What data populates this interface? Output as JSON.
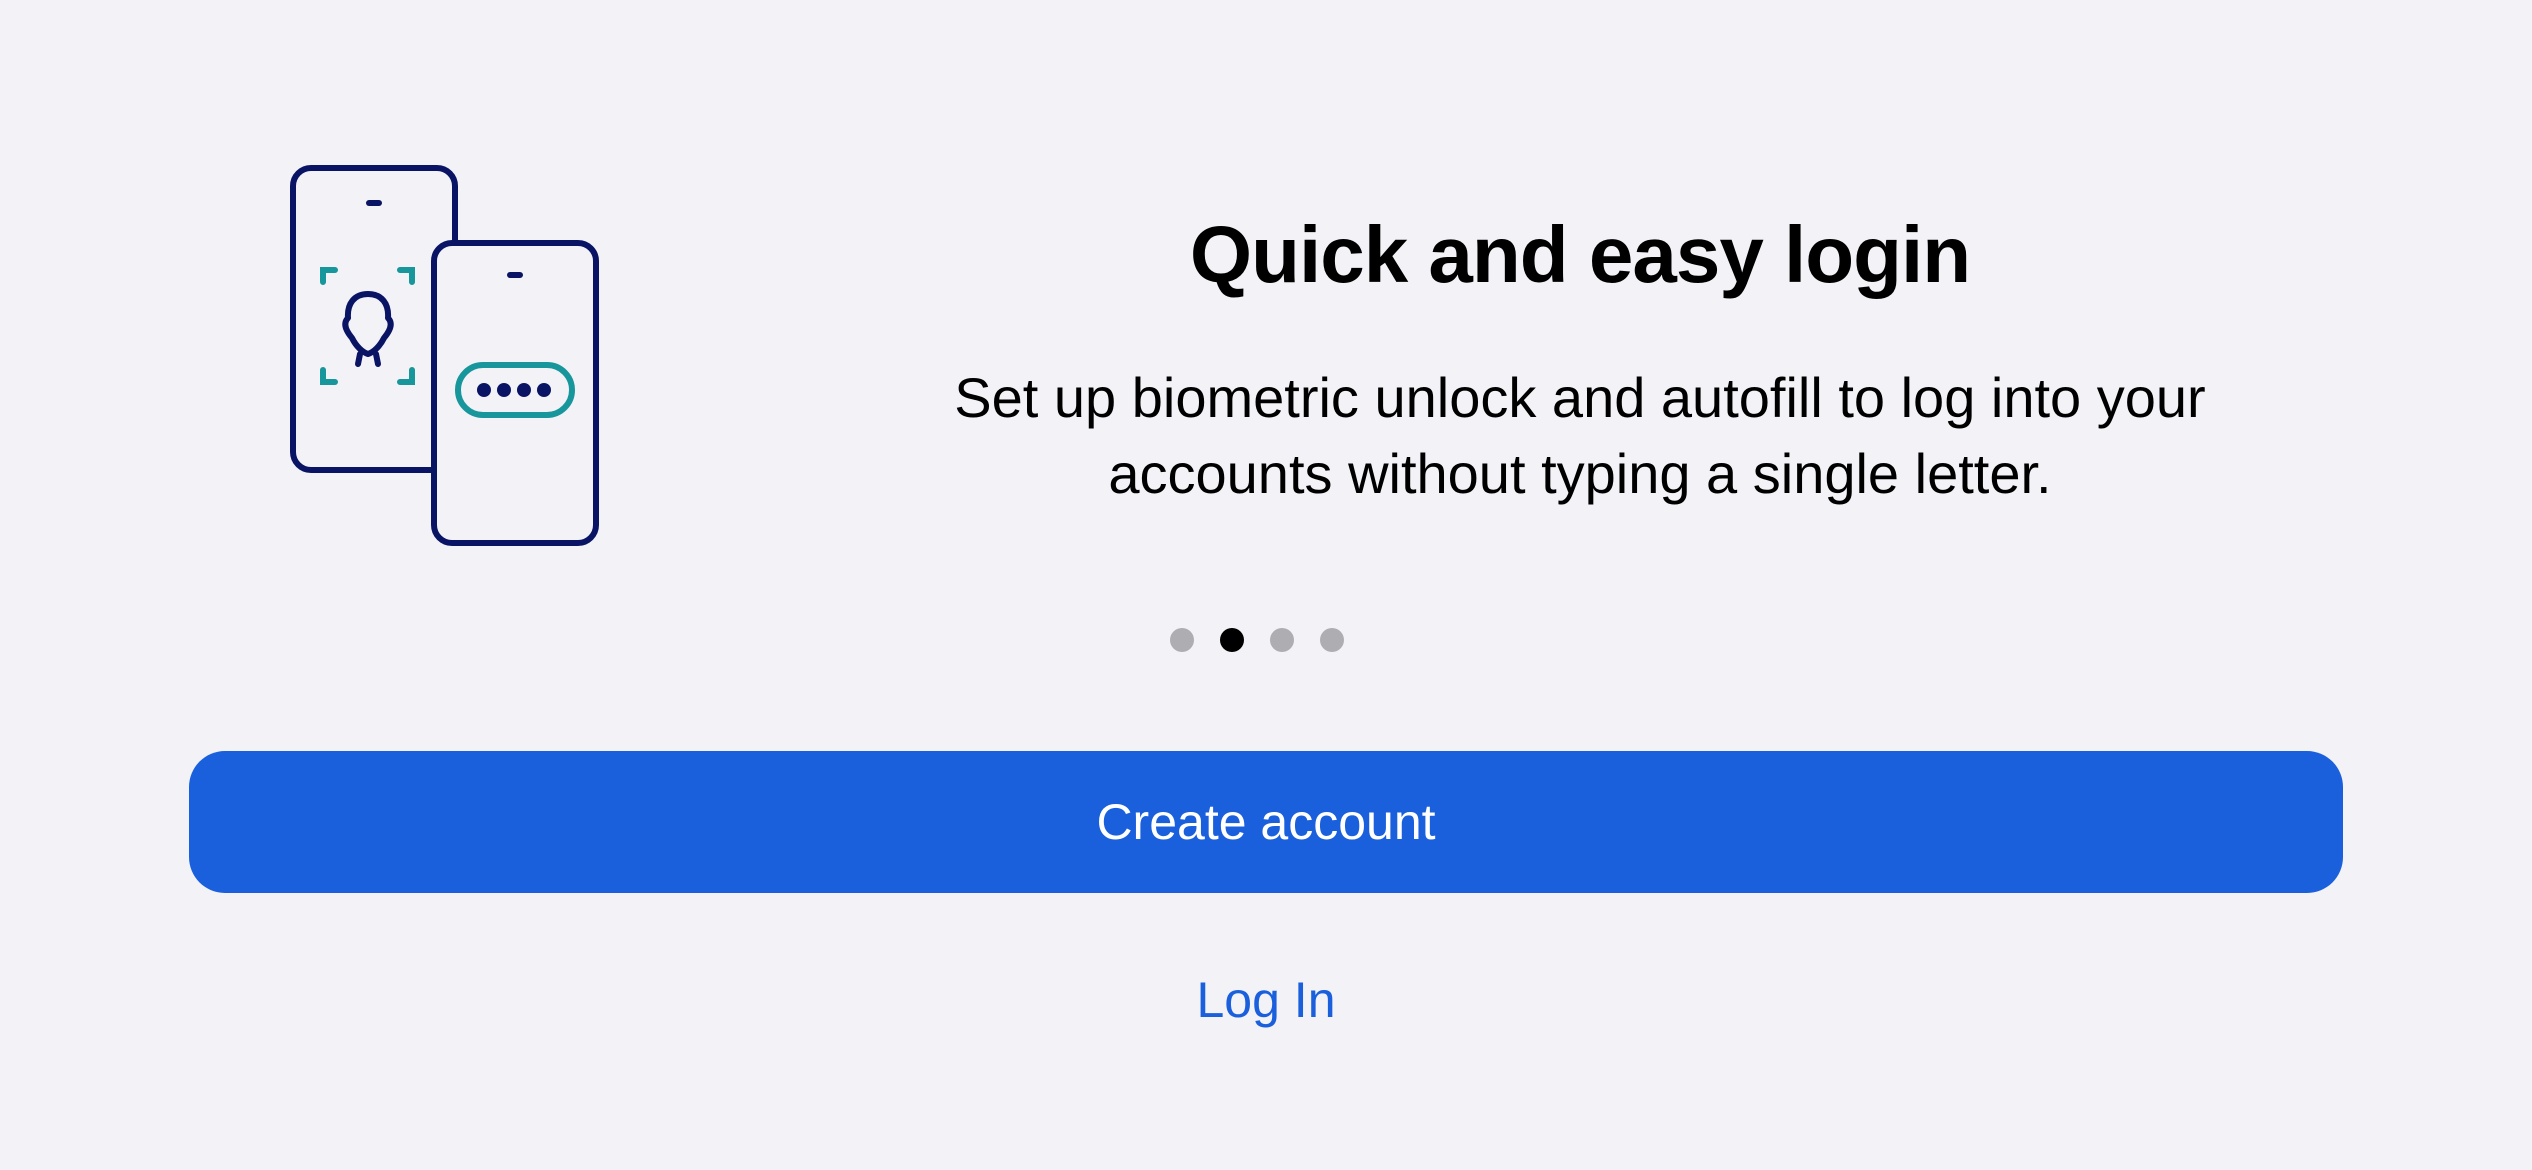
{
  "onboarding": {
    "title": "Quick and easy login",
    "description_line1": "Set up biometric unlock and autofill to log into your",
    "description_line2": "accounts without typing a single letter.",
    "illustration_icon": "phones-biometric-password-icon",
    "page_indicator": {
      "total": 4,
      "current": 2
    }
  },
  "actions": {
    "create_account_label": "Create account",
    "login_label": "Log In"
  },
  "colors": {
    "background": "#f2f2f7",
    "primary": "#1a5fdc",
    "illustration_navy": "#0a1464",
    "illustration_teal": "#17969b"
  }
}
